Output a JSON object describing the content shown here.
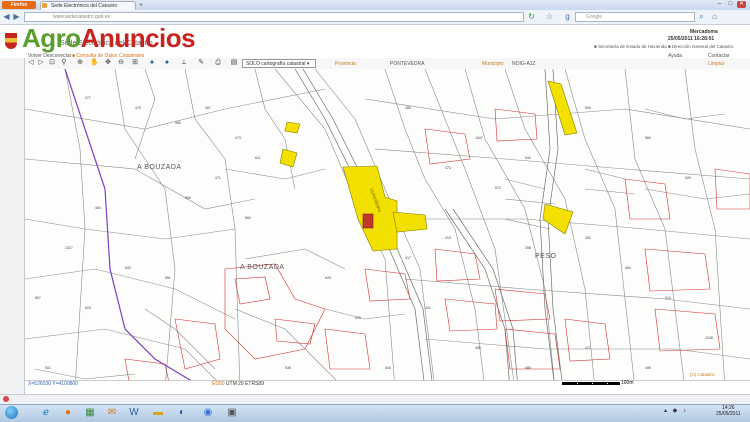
{
  "browser": {
    "app_button": "Firefox",
    "tab_title": "Sede Electrónica del Catastro",
    "new_tab": "+",
    "url": "www.sedecatastro.gob.es",
    "search_placeholder": "Google",
    "win_min": "–",
    "win_max": "□",
    "win_close": "✕"
  },
  "header": {
    "watermark_agro": "Agro",
    "watermark_anuncios": "Anuncios",
    "sede_title": "Sede Electrónica del Catastro",
    "user": "Mercadoma",
    "datetime": "25/05/2011  16:28:01",
    "ministry_links": "■ Secretaría de Estado de Hacienda   ■ Dirección General del Catastro",
    "back_link": "Volver Desconectar",
    "consulta_link": "■ Consulta de Datos Catastrales",
    "help": "Ayuda",
    "contact": "Contactar"
  },
  "toolbar": {
    "layer_select": "SOLO cartografía catastral ▾",
    "provincia_label": "Provincia:",
    "provincia_value": "PONTEVEDRA",
    "municipio_label": "Municipio:",
    "municipio_value": "NOIG-A1Z",
    "clear": "Limpiar"
  },
  "map": {
    "place_1": "A BOUZADA",
    "place_2": "A BOUZADA",
    "place_3": "PESO",
    "road_label": "CORDIÑEIRA"
  },
  "status": {
    "coords": "X=536030  Y=4100800",
    "projection_tag": "ED50",
    "projection": "UTM 29 ETRS89",
    "scale_label": "100m",
    "copyright": "(C) Catastro"
  },
  "taskbar": {
    "time": "14:26",
    "date": "25/05/2011"
  }
}
